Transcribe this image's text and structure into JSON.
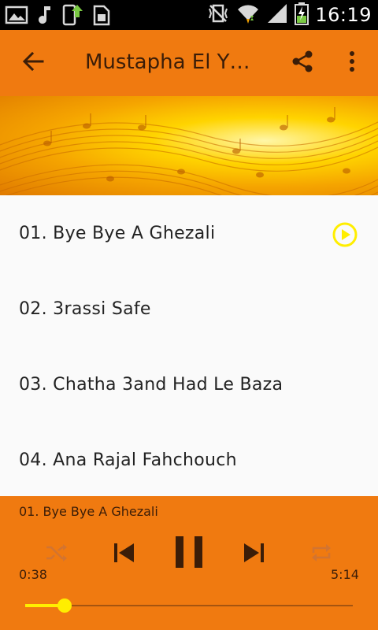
{
  "status_bar": {
    "time": "16:19",
    "left_icons": [
      "gallery-icon",
      "music-note-icon",
      "app-update-icon",
      "sd-card-icon"
    ],
    "right_icons": [
      "vibrate-icon",
      "wifi-icon",
      "signal-icon",
      "battery-charging-icon"
    ]
  },
  "app_bar": {
    "title": "Mustapha El Y…",
    "icons": [
      "back-arrow-icon",
      "share-icon",
      "more-vert-icon"
    ]
  },
  "tracks": [
    {
      "label": "01. Bye Bye A Ghezali",
      "playing": true
    },
    {
      "label": "02. 3rassi Safe",
      "playing": false
    },
    {
      "label": "03. Chatha 3and Had Le Baza",
      "playing": false
    },
    {
      "label": "04. Ana Rajal Fahchouch",
      "playing": false
    }
  ],
  "player": {
    "now_playing": "01. Bye Bye A Ghezali",
    "elapsed": "0:38",
    "duration": "5:14",
    "progress": 0.12,
    "state": "playing",
    "controls": [
      "shuffle-icon",
      "previous-icon",
      "pause-icon",
      "next-icon",
      "repeat-icon"
    ]
  },
  "colors": {
    "accent": "#f07a10",
    "accent_text": "#3b1d08",
    "highlight": "#ffee00",
    "list_bg": "#fafafa",
    "status_bar": "#000000"
  }
}
